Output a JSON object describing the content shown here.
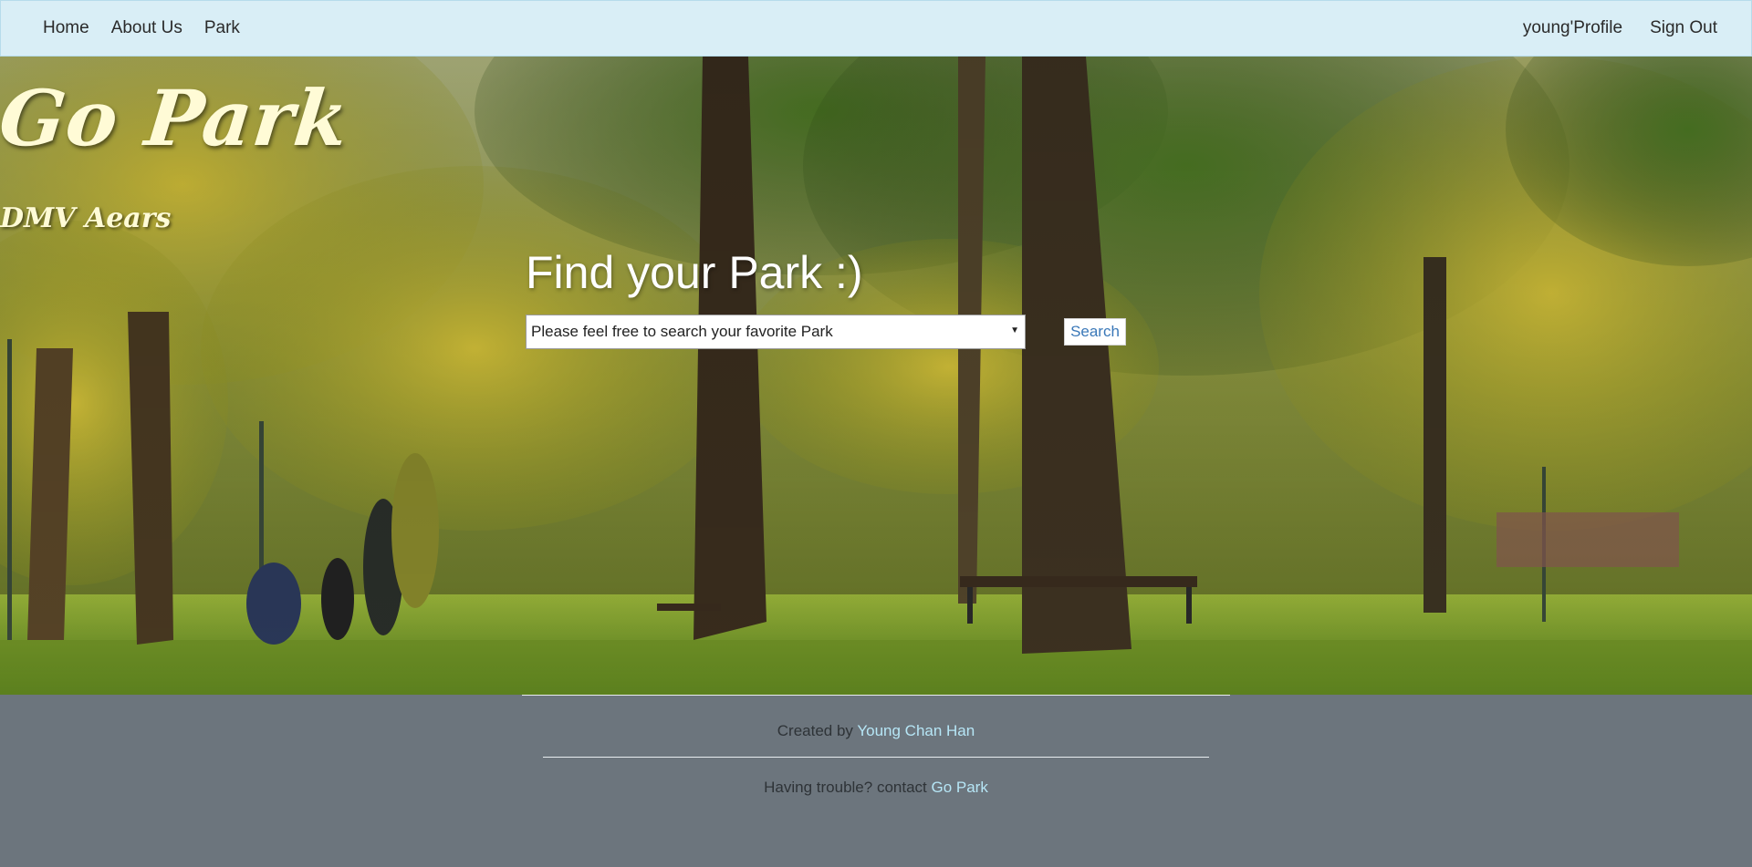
{
  "navbar": {
    "left_links": [
      {
        "label": "Home"
      },
      {
        "label": "About Us"
      },
      {
        "label": "Park"
      }
    ],
    "right_links": [
      {
        "label": "young'Profile"
      },
      {
        "label": "Sign Out"
      }
    ],
    "background_color": "#d9eef6"
  },
  "hero": {
    "brand_title": "Go Park",
    "brand_subtitle": "DMV Aears",
    "heading": "Find your Park :)",
    "search": {
      "selected_value": "Please feel free to search your favorite Park",
      "button_label": "Search"
    }
  },
  "footer": {
    "created_prefix": "Created by ",
    "author_link": "Young Chan Han",
    "contact_prefix": "Having trouble? contact ",
    "contact_link": "Go Park",
    "background_color": "#6c757d",
    "link_color": "#b6e6f6"
  }
}
